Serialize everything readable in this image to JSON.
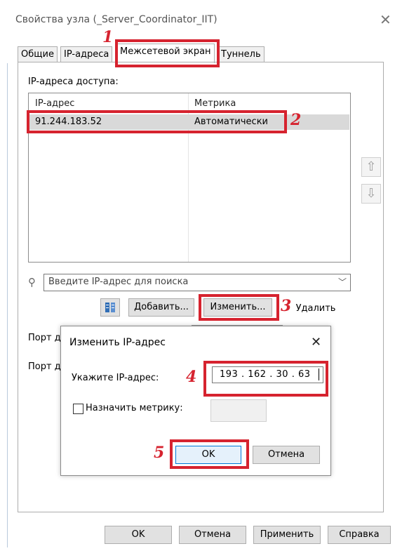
{
  "window": {
    "title": "Свойства узла (_Server_Coordinator_IIT)"
  },
  "tabs": [
    {
      "label": "Общие"
    },
    {
      "label": "IP-адреса"
    },
    {
      "label": "Межсетевой экран"
    },
    {
      "label": "Туннель"
    }
  ],
  "section": {
    "access_label": "IP-адреса доступа:"
  },
  "list": {
    "columns": [
      "IP-адрес",
      "Метрика"
    ],
    "rows": [
      {
        "ip": "91.244.183.52",
        "metric": "Автоматически"
      }
    ]
  },
  "search": {
    "placeholder": "Введите IP-адрес для поиска"
  },
  "buttons": {
    "add": "Добавить...",
    "edit": "Изменить...",
    "delete": "Удалить",
    "ok": "OK",
    "cancel": "Отмена",
    "apply": "Применить",
    "help": "Справка"
  },
  "behind": {
    "port1": "Порт д",
    "port2": "Порт д"
  },
  "dialog": {
    "title": "Изменить IP-адрес",
    "ip_label": "Укажите IP-адрес:",
    "ip_parts": [
      "193",
      "162",
      "30",
      "63"
    ],
    "ip_separator": ".",
    "metric_label": "Назначить метрику:",
    "ok": "OK",
    "cancel": "Отмена"
  },
  "annotations": {
    "m1": "1",
    "m2": "2",
    "m3": "3",
    "m4": "4",
    "m5": "5",
    "color": "#d6232f"
  },
  "icons": {
    "close": "close-icon",
    "up": "arrow-up-icon",
    "down": "arrow-down-icon",
    "search": "search-icon",
    "import": "import-icon"
  }
}
